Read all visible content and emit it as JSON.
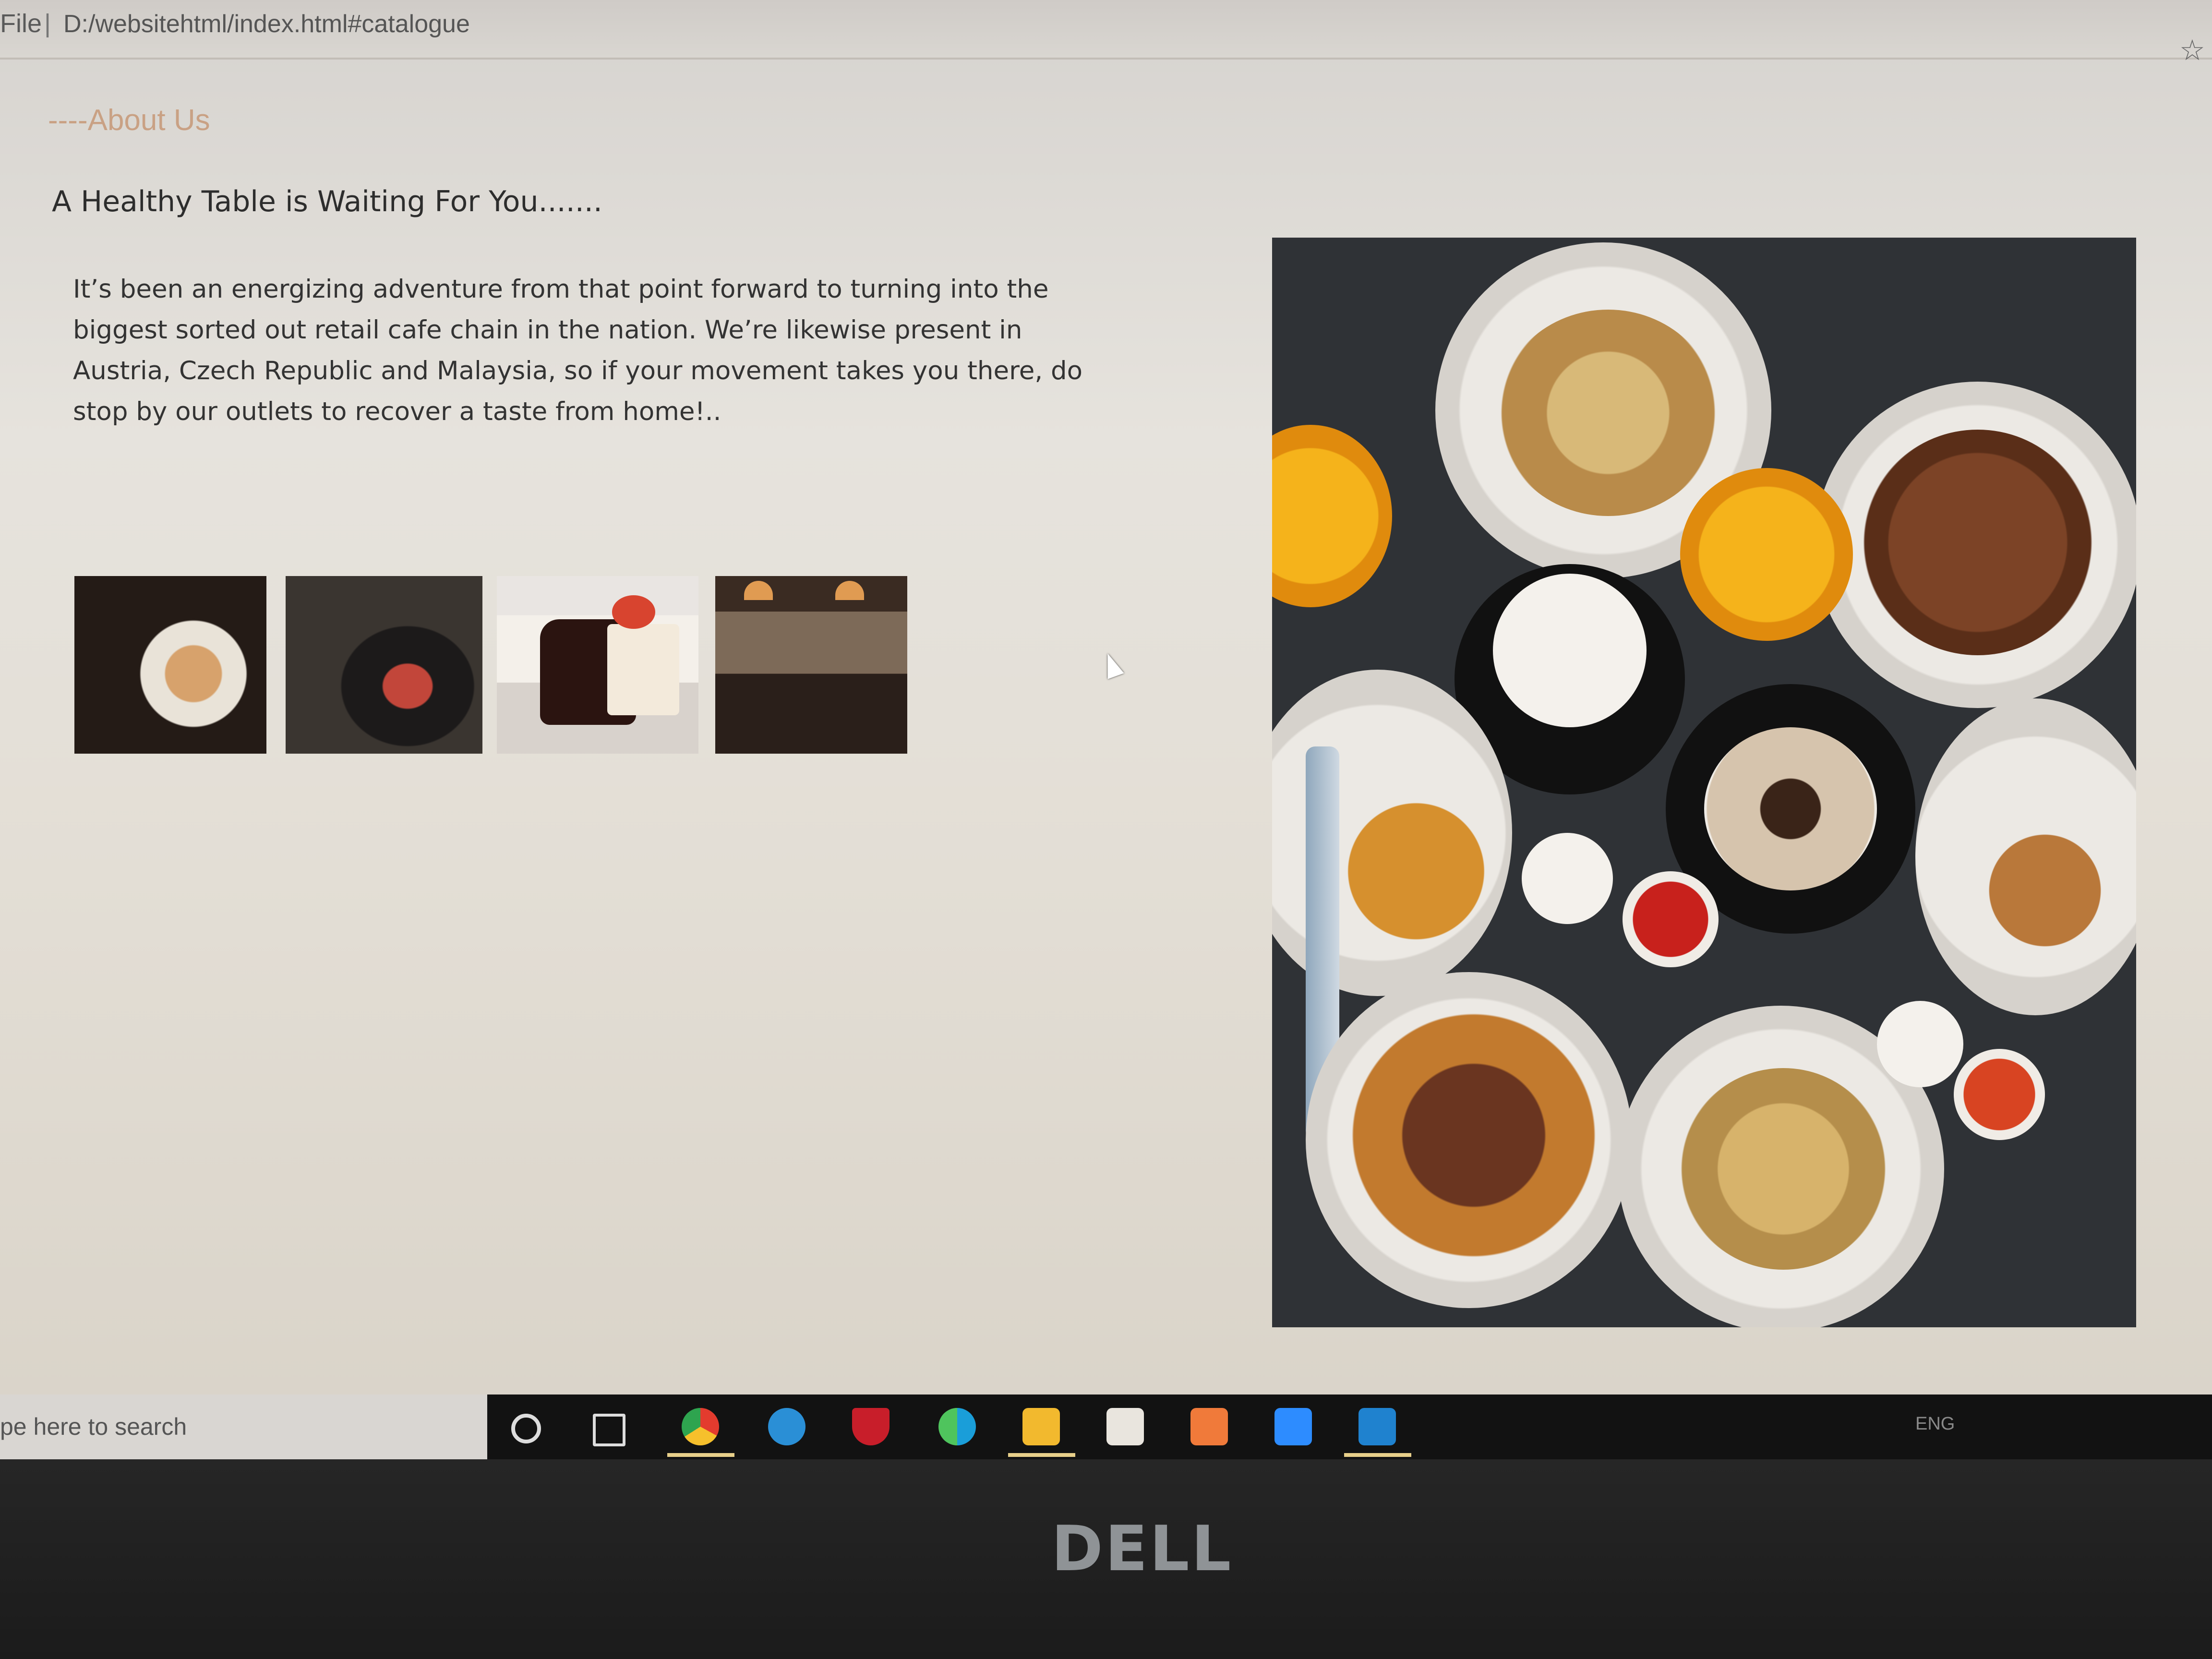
{
  "browser": {
    "file_label": "File",
    "separator": "|",
    "url": "D:/websitehtml/index.html#catalogue",
    "star_glyph": "☆"
  },
  "page": {
    "section_label": "----About Us",
    "headline": "A Healthy Table is Waiting For You.......",
    "paragraph": "It’s been an energizing adventure from that point forward to turning into the biggest sorted out retail cafe chain in the nation. We’re likewise present in Austria, Czech Republic and Malaysia, so if your movement takes you there, do stop by our outlets to recover a taste from home!..",
    "accent_color": "#c9a184"
  },
  "taskbar": {
    "search_text": "pe here to search",
    "tray_lang": "ENG",
    "apps": [
      "cortana-icon",
      "task-view-icon",
      "chrome-icon",
      "safari-icon",
      "mcafee-icon",
      "edge-icon",
      "file-explorer-icon",
      "store-icon",
      "xampp-icon",
      "zoom-icon",
      "vscode-icon"
    ]
  },
  "laptop": {
    "brand": "DELL"
  }
}
